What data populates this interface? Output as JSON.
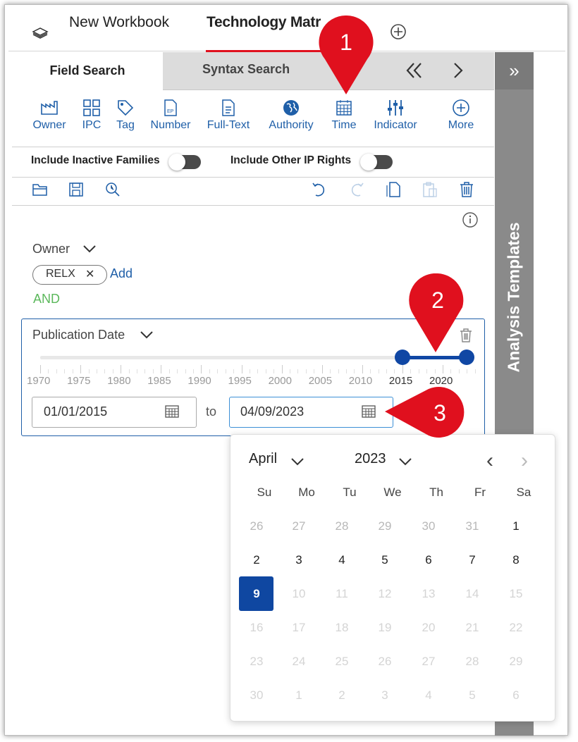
{
  "header": {
    "workbook_label": "New Workbook",
    "technology_tab_label": "Technology Matr",
    "add_tab_icon": "plus-circle-icon"
  },
  "search_tabs": {
    "field_search": "Field Search",
    "syntax_search": "Syntax Search"
  },
  "side_panel": {
    "collapse_icon": "»",
    "label": "Analysis Templates"
  },
  "toolbar": {
    "owner": "Owner",
    "ipc": "IPC",
    "tag": "Tag",
    "number": "Number",
    "fulltext": "Full-Text",
    "authority": "Authority",
    "time": "Time",
    "indicator": "Indicator",
    "more": "More",
    "number_icon_text": "EP"
  },
  "toggles": {
    "inactive_families": "Include Inactive Families",
    "other_ip_rights": "Include Other IP Rights"
  },
  "owner": {
    "label": "Owner",
    "chip": "RELX",
    "chip_remove": "✕",
    "add": "Add",
    "operator": "AND"
  },
  "publication_date": {
    "label": "Publication Date",
    "ticks": [
      "1970",
      "1975",
      "1980",
      "1985",
      "1990",
      "1995",
      "2000",
      "2005",
      "2010",
      "2015",
      "2020"
    ],
    "range_start": "2015",
    "range_end": "2023",
    "from_value": "01/01/2015",
    "to_label": "to",
    "to_value": "04/09/2023"
  },
  "calendar": {
    "month": "April",
    "year": "2023",
    "prev": "‹",
    "next": "›",
    "weekdays": [
      "Su",
      "Mo",
      "Tu",
      "We",
      "Th",
      "Fr",
      "Sa"
    ],
    "weeks": [
      [
        "26",
        "27",
        "28",
        "29",
        "30",
        "31",
        "1"
      ],
      [
        "2",
        "3",
        "4",
        "5",
        "6",
        "7",
        "8"
      ],
      [
        "9",
        "10",
        "11",
        "12",
        "13",
        "14",
        "15"
      ],
      [
        "16",
        "17",
        "18",
        "19",
        "20",
        "21",
        "22"
      ],
      [
        "23",
        "24",
        "25",
        "26",
        "27",
        "28",
        "29"
      ],
      [
        "30",
        "1",
        "2",
        "3",
        "4",
        "5",
        "6"
      ]
    ],
    "selected_day": "9"
  },
  "markers": [
    "1",
    "2",
    "3"
  ],
  "colors": {
    "accent_blue": "#1f5fa8",
    "selected_blue": "#0f47a1",
    "marker_red": "#e0101e",
    "and_green": "#5bb85b",
    "panel_gray": "#8a8a8a"
  }
}
